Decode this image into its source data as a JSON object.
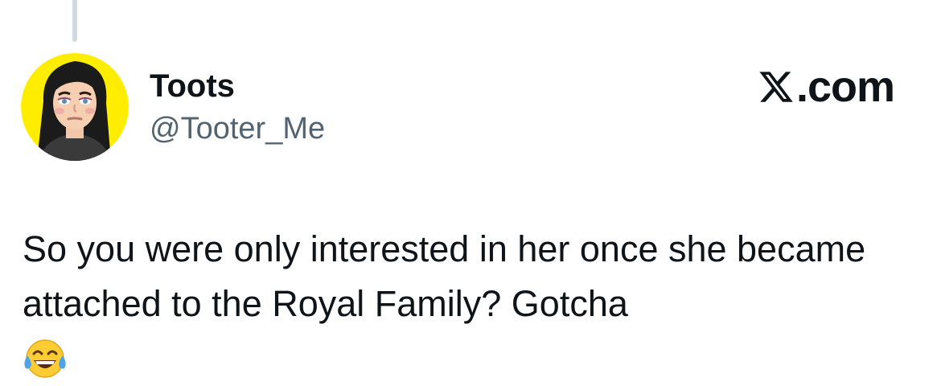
{
  "tweet": {
    "author": {
      "display_name": "Toots",
      "handle": "@Tooter_Me",
      "avatar_icon": "bitmoji-avatar"
    },
    "brand": {
      "icon": "x-logo-icon",
      "text": ".com"
    },
    "text": "So you were only interested in her once she became attached to the Royal Family? Gotcha",
    "emoji": "face-with-tears-of-joy-icon"
  },
  "colors": {
    "text_primary": "#0f1419",
    "text_secondary": "#536471",
    "thread_line": "#cfd9de",
    "avatar_background": "#ffed00",
    "background": "#ffffff"
  }
}
